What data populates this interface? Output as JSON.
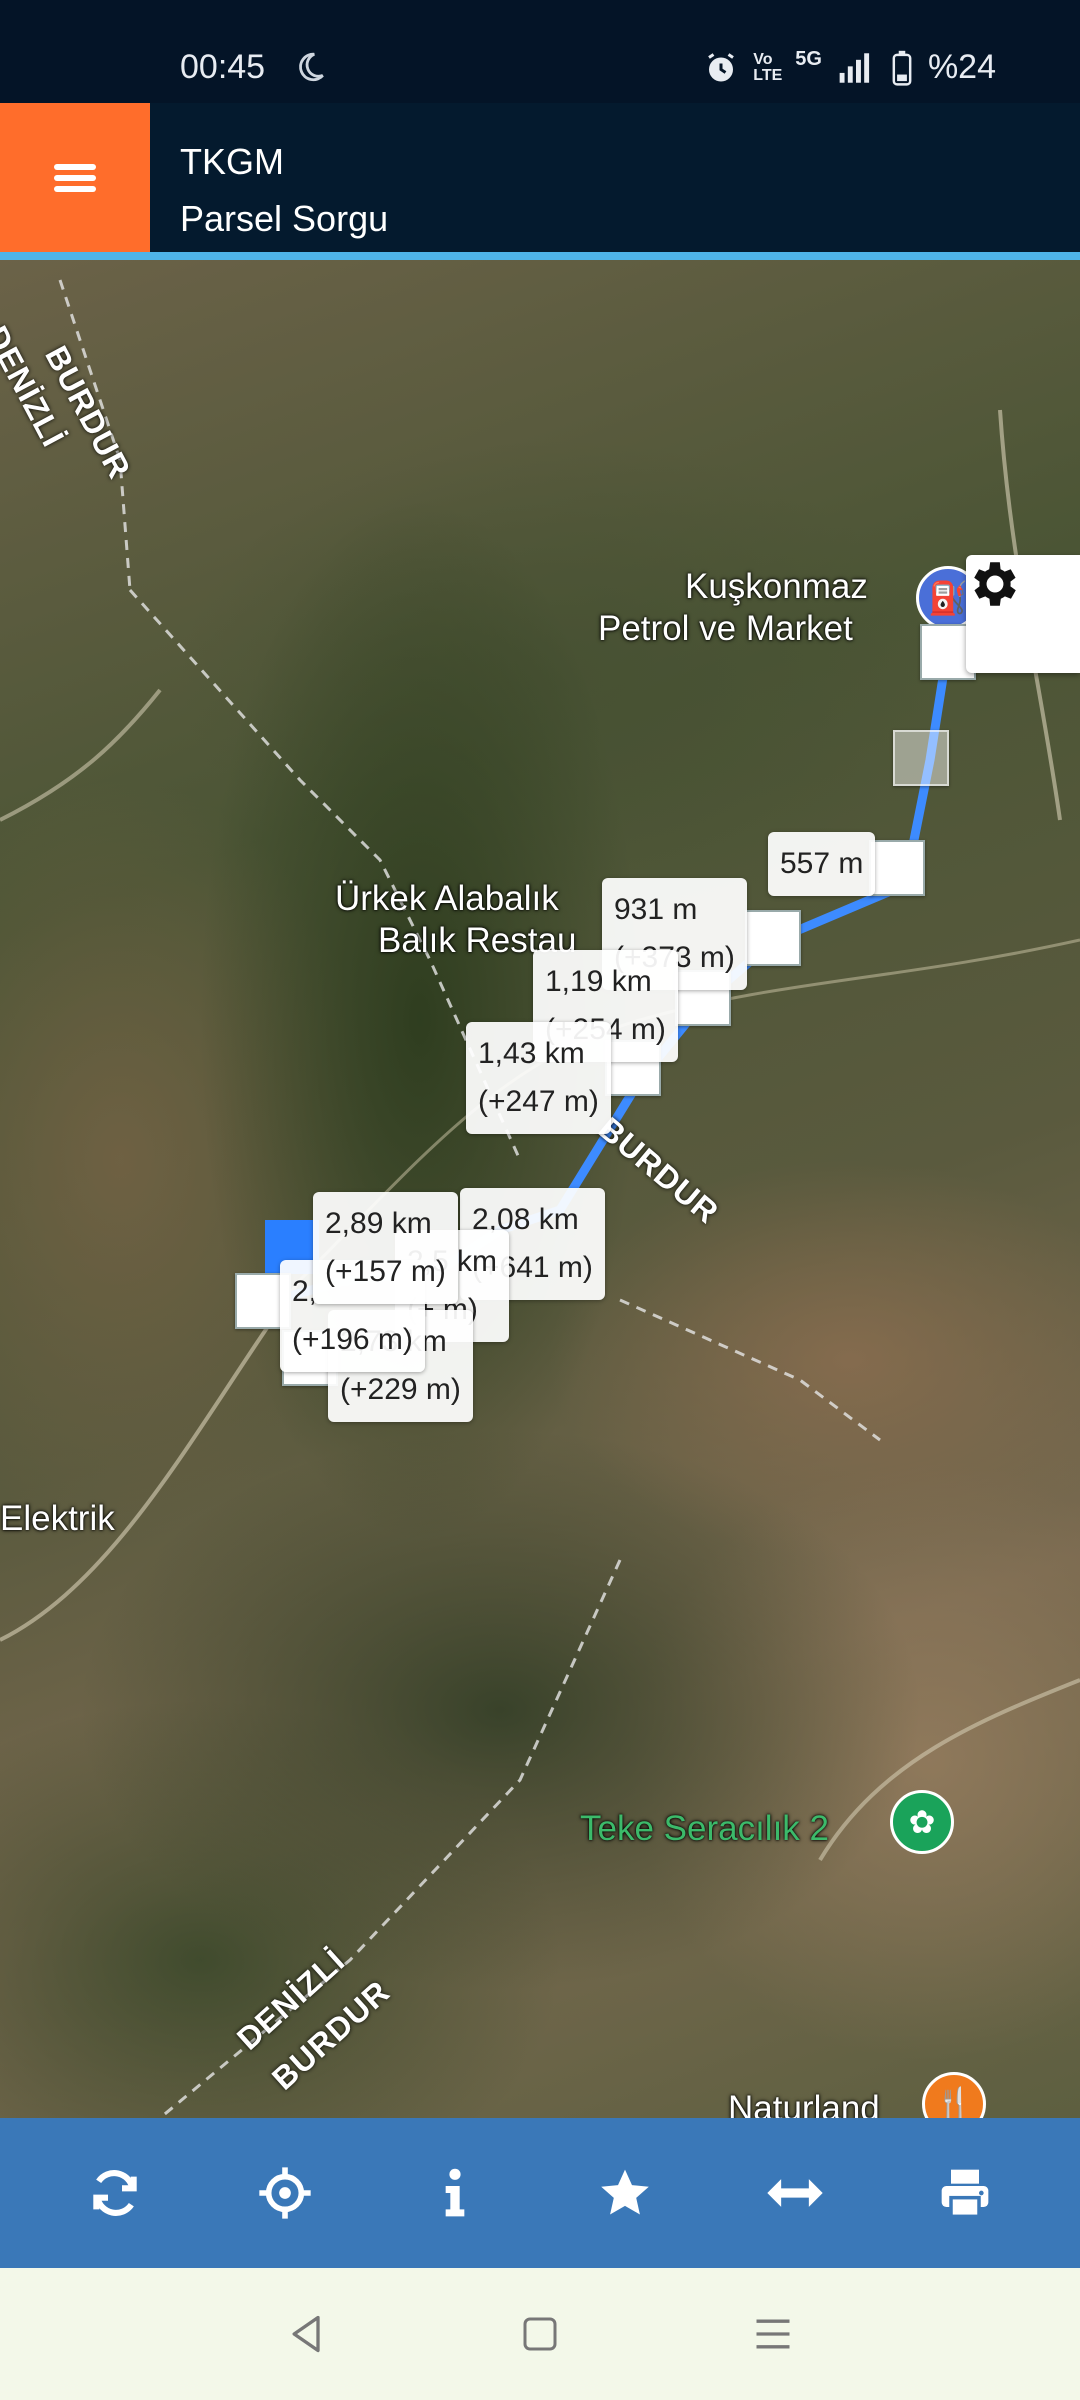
{
  "status_bar": {
    "time": "00:45",
    "volte": "Vo LTE",
    "network": "5G",
    "battery": "%24"
  },
  "app_bar": {
    "title": "TKGM",
    "subtitle": "Parsel Sorgu",
    "menu_color": "#ff6d2b",
    "accent_color": "#4fb4e8"
  },
  "map": {
    "places": {
      "petrol_line1": "Kuşkonmaz",
      "petrol_line2": "Petrol ve Market",
      "restaurant_line1": "Ürkek Alabalık",
      "restaurant_line2": "Balık Restau",
      "elektrik": "Elektrik",
      "teke": "Teke Seracılık 2",
      "naturland": "Naturland"
    },
    "borders": {
      "top_left_1": "BURDUR",
      "top_left_2": "DENİZLİ",
      "mid": "BURDUR",
      "bottom_1": "DENİZLİ",
      "bottom_2": "BURDUR"
    },
    "measure_labels": [
      {
        "dist": "557 m",
        "delta": ""
      },
      {
        "dist": "931 m",
        "delta": "(+373 m)"
      },
      {
        "dist": "1,19 km",
        "delta": "(+254 m)"
      },
      {
        "dist": "1,43 km",
        "delta": "(+247 m)"
      },
      {
        "dist": "2,08 km",
        "delta": "(+641 m)"
      },
      {
        "dist": "2,5 km",
        "delta": "(+ m)"
      },
      {
        "dist": "2,73 km",
        "delta": "(+229 m)"
      },
      {
        "dist": "2,89 km",
        "delta": "(+157 m)"
      },
      {
        "dist": "2,",
        "delta": "(+196 m)"
      }
    ],
    "route_color": "#3d8bff"
  },
  "toolbar": {
    "background": "#3a78b8",
    "buttons": [
      "refresh-icon",
      "locate-icon",
      "info-icon",
      "star-icon",
      "measure-icon",
      "print-icon"
    ]
  },
  "nav": {
    "buttons": [
      "back-icon",
      "home-icon",
      "recents-icon"
    ]
  }
}
